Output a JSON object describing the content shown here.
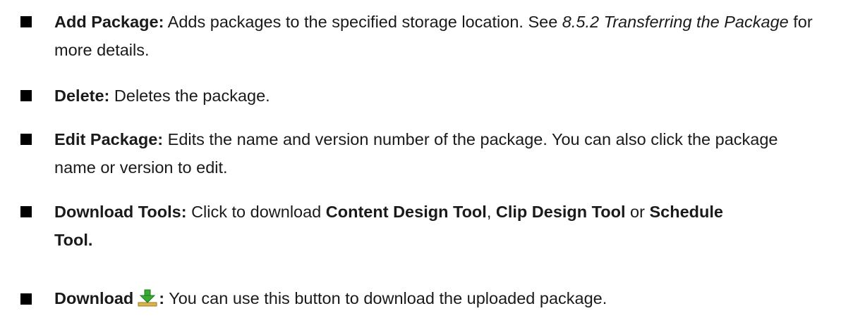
{
  "items": [
    {
      "term": "Add Package:",
      "desc1": " Adds packages to the specified storage location. See ",
      "ref": "8.5.2 Transferring the Package",
      "desc2": " for more details."
    },
    {
      "term": "Delete:",
      "desc1": " Deletes the package."
    },
    {
      "term": "Edit Package:",
      "desc1": " Edits the name and version number of the package. You can also click the package name or version to edit."
    },
    {
      "term": "Download Tools:",
      "desc1": " Click to download ",
      "tool1": "Content Design Tool",
      "sep1": ", ",
      "tool2": "Clip Design Tool",
      "sep2": " or ",
      "tool3": "Schedule Tool",
      "end": "."
    },
    {
      "term": "Download",
      "colon": ":",
      "desc1": " You can use this button to download the uploaded package.",
      "icon": "download-arrow-icon"
    }
  ],
  "colors": {
    "bullet": "#000000",
    "icon_green": "#3aa832",
    "icon_tray": "#d9b44a"
  }
}
